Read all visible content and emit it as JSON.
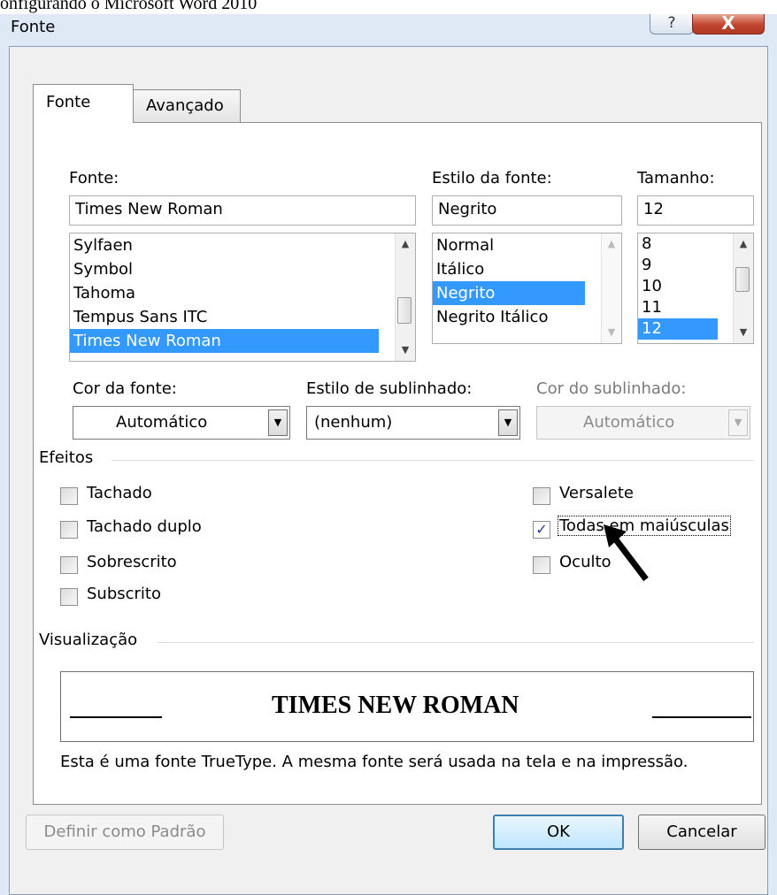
{
  "document_caption": "onfigurando o Microsoft Word 2010",
  "window": {
    "title": "Fonte",
    "help_glyph": "?",
    "close_glyph": "X"
  },
  "tabs": [
    {
      "label": "Fonte",
      "active": true
    },
    {
      "label": "Avançado",
      "active": false
    }
  ],
  "font": {
    "label": "Fonte:",
    "value": "Times New Roman",
    "items": [
      "Sylfaen",
      "Symbol",
      "Tahoma",
      "Tempus Sans ITC",
      "Times New Roman"
    ],
    "selected": "Times New Roman"
  },
  "style": {
    "label": "Estilo da fonte:",
    "value": "Negrito",
    "items": [
      "Normal",
      "Itálico",
      "Negrito",
      "Negrito Itálico"
    ],
    "selected": "Negrito"
  },
  "size": {
    "label": "Tamanho:",
    "value": "12",
    "items": [
      "8",
      "9",
      "10",
      "11",
      "12"
    ],
    "selected": "12"
  },
  "font_color": {
    "label": "Cor da fonte:",
    "value": "Automático"
  },
  "underline_style": {
    "label": "Estilo de sublinhado:",
    "value": "(nenhum)"
  },
  "underline_color": {
    "label": "Cor do sublinhado:",
    "value": "Automático",
    "enabled": false
  },
  "effects": {
    "label": "Efeitos",
    "left": [
      {
        "label": "Tachado",
        "checked": false
      },
      {
        "label": "Tachado duplo",
        "checked": false
      },
      {
        "label": "Sobrescrito",
        "checked": false
      },
      {
        "label": "Subscrito",
        "checked": false
      }
    ],
    "right": [
      {
        "label": "Versalete",
        "checked": false
      },
      {
        "label": "Todas em maiúsculas",
        "checked": true
      },
      {
        "label": "Oculto",
        "checked": false
      }
    ]
  },
  "preview": {
    "label": "Visualização",
    "sample": "TIMES NEW ROMAN",
    "note": "Esta é uma fonte TrueType. A mesma fonte será usada na tela e na impressão."
  },
  "buttons": {
    "set_default": "Definir como Padrão",
    "ok": "OK",
    "cancel": "Cancelar"
  },
  "colors": {
    "selection": "#3399ff",
    "dialog_bg": "#f0f0f0",
    "frame": "#dfe9f5",
    "close": "#c0442e"
  },
  "annotation": {
    "icon": "arrow-pointer-icon"
  }
}
